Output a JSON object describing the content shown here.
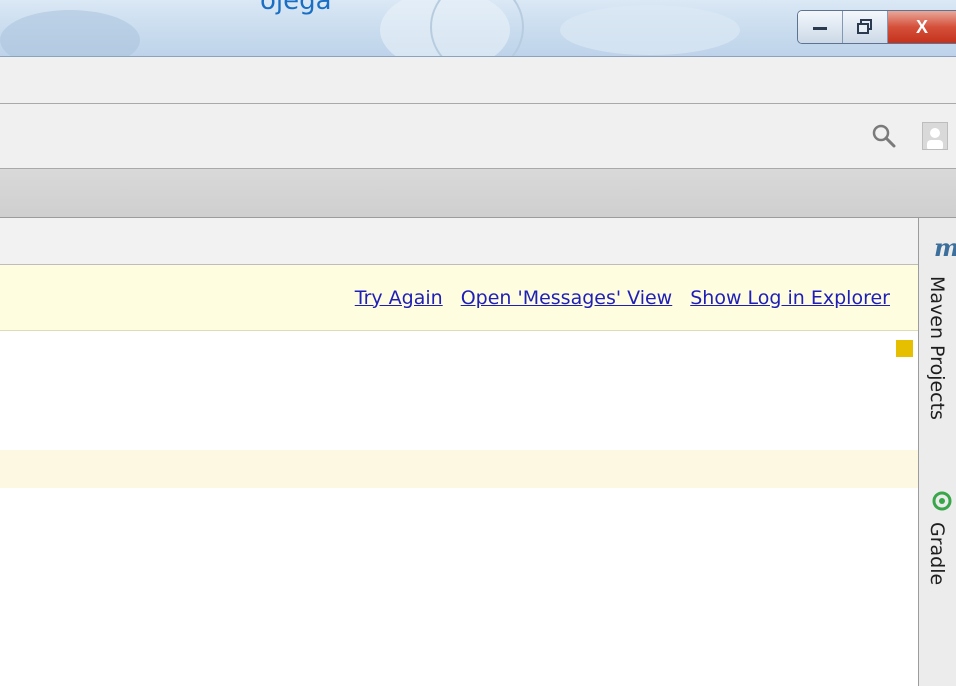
{
  "window": {
    "title": "ojega",
    "controls": {
      "minimize": "minimize-icon",
      "maximize": "restore-icon",
      "close": "X"
    }
  },
  "toolbar": {
    "icons": [
      "search-icon",
      "user-avatar-icon"
    ]
  },
  "notification": {
    "links": {
      "try_again": "Try Again",
      "open_messages": "Open 'Messages' View",
      "show_log": "Show Log in Explorer"
    },
    "background": "#fefde0",
    "link_color": "#1f1fb8"
  },
  "right_panel": {
    "maven_label": "Maven Projects",
    "maven_icon_text": "m",
    "gradle_label": "Gradle"
  },
  "colors": {
    "marker": "#e5bf00",
    "caret_line": "#fdf8e2"
  }
}
